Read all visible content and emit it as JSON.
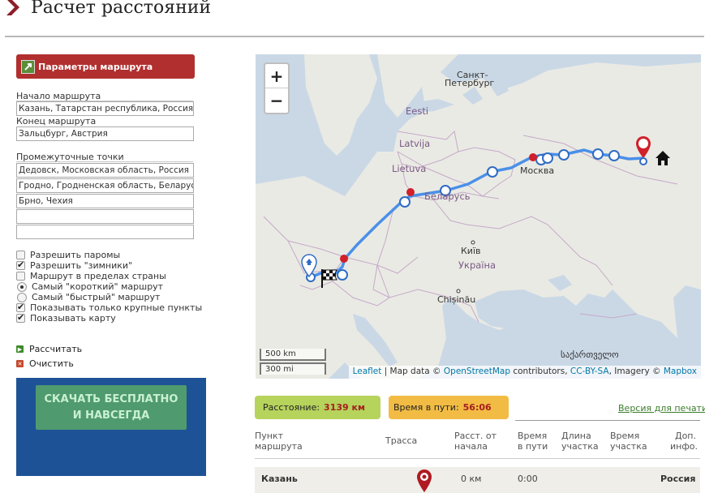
{
  "header": {
    "title": "Расчет расстояний"
  },
  "params": {
    "title": "Параметры маршрута",
    "start_label": "Начало маршрута",
    "start_value": "Казань, Татарстан республика, Россия",
    "end_label": "Конец маршрута",
    "end_value": "Зальцбург, Австрия",
    "waypoints_label": "Промежуточные точки",
    "waypoints": [
      "Дедовск, Московская область, Россия",
      "Гродно, Гродненская область, Беларусь",
      "Брно, Чехия",
      "",
      ""
    ]
  },
  "options": [
    {
      "label": "Разрешить паромы",
      "type": "checkbox",
      "checked": false
    },
    {
      "label": "Разрешить \"зимники\"",
      "type": "checkbox",
      "checked": true
    },
    {
      "label": "Маршрут в пределах страны",
      "type": "checkbox",
      "checked": false
    },
    {
      "label": "Самый \"короткий\" маршрут",
      "type": "radio",
      "checked": true
    },
    {
      "label": "Самый \"быстрый\" маршрут",
      "type": "radio",
      "checked": false
    },
    {
      "label": "Показывать только крупные пункты",
      "type": "checkbox",
      "checked": true
    },
    {
      "label": "Показывать карту",
      "type": "checkbox",
      "checked": true
    }
  ],
  "actions": {
    "calculate": "Рассчитать",
    "clear": "Очистить"
  },
  "ad": {
    "line1": "СКАЧАТЬ БЕСПЛАТНО",
    "line2": "И НАВСЕГДА"
  },
  "map": {
    "zoom_in": "+",
    "zoom_out": "−",
    "labels": {
      "spb_1": "Санкт-",
      "spb_2": "Петербург",
      "eesti": "Eesti",
      "latvija": "Latvija",
      "lietuva": "Lietuva",
      "belarus": "Беларусь",
      "moskva": "Москва",
      "kyiv": "Київ",
      "ukraina": "Україна",
      "chisinau": "Chișinău",
      "georgia": "საქართველო"
    },
    "scale_km": "500 km",
    "scale_mi": "300 mi",
    "attribution": {
      "leaflet": "Leaflet",
      "sep1": " | Map data © ",
      "osm": "OpenStreetMap",
      "sep2": " contributors, ",
      "license": "CC-BY-SA",
      "sep3": ", Imagery © ",
      "mapbox": "Mapbox"
    },
    "colors": {
      "route": "#4a90e8",
      "waypoint": "#d0202a",
      "water": "#cad8e6",
      "land": "#eaeae4"
    }
  },
  "stats": {
    "distance_label": "Расстояние:",
    "distance_value": "3139 км",
    "time_label": "Время в пути:",
    "time_value": "56:06",
    "print_link": "Версия для печати"
  },
  "table": {
    "headers": {
      "point_1": "Пункт",
      "point_2": "маршрута",
      "road": "Трасса",
      "dist_1": "Расст. от",
      "dist_2": "начала",
      "time_1": "Время",
      "time_2": "в пути",
      "seglen_1": "Длина",
      "seglen_2": "участка",
      "segtime_1": "Время",
      "segtime_2": "участка",
      "info_1": "Доп.",
      "info_2": "инфо."
    },
    "rows": [
      {
        "point": "Казань",
        "dist": "0 км",
        "time": "0:00",
        "info": "Россия"
      }
    ]
  }
}
